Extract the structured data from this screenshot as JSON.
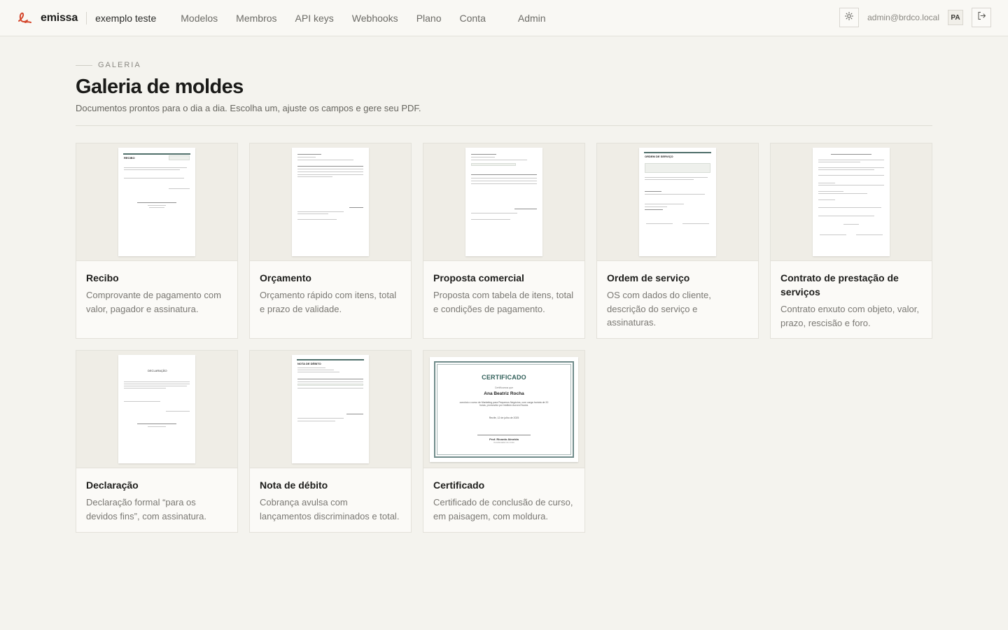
{
  "header": {
    "brand": "emissa",
    "org": "exemplo teste",
    "nav": [
      "Modelos",
      "Membros",
      "API keys",
      "Webhooks",
      "Plano",
      "Conta",
      "Admin"
    ],
    "user_email": "admin@brdco.local",
    "avatar_initials": "PA"
  },
  "page": {
    "eyebrow": "GALERIA",
    "title": "Galeria de moldes",
    "subtitle": "Documentos prontos para o dia a dia. Escolha um, ajuste os campos e gere seu PDF."
  },
  "templates": [
    {
      "name": "Recibo",
      "desc": "Comprovante de pagamento com valor, pagador e assinatura.",
      "thumb_title": "RECIBO"
    },
    {
      "name": "Orçamento",
      "desc": "Orçamento rápido com itens, total e prazo de validade.",
      "thumb_title": ""
    },
    {
      "name": "Proposta comercial",
      "desc": "Proposta com tabela de itens, total e condições de pagamento.",
      "thumb_title": ""
    },
    {
      "name": "Ordem de serviço",
      "desc": "OS com dados do cliente, descrição do serviço e assinaturas.",
      "thumb_title": "ORDEM DE SERVIÇO"
    },
    {
      "name": "Contrato de prestação de serviços",
      "desc": "Contrato enxuto com objeto, valor, prazo, rescisão e foro.",
      "thumb_title": ""
    },
    {
      "name": "Declaração",
      "desc": "Declaração formal “para os devidos fins”, com assinatura.",
      "thumb_title": "DECLARAÇÃO"
    },
    {
      "name": "Nota de débito",
      "desc": "Cobrança avulsa com lançamentos discriminados e total.",
      "thumb_title": "NOTA DE DÉBITO"
    },
    {
      "name": "Certificado",
      "desc": "Certificado de conclusão de curso, em paisagem, com moldura.",
      "thumb_title": "CERTIFICADO"
    }
  ],
  "certificate_preview": {
    "title": "CERTIFICADO",
    "certify": "Certificamos que",
    "recipient": "Ana Beatriz Rocha",
    "body": "concluiu o curso de Marketing para Pequenos Negócios, com carga horária de 20 horas, promovido por Instituto Aurora Escola.",
    "place_date": "Recife, 12 de julho de 2025",
    "signer": "Prof. Ricardo Almeida",
    "signer_role": "Coordenador do curso"
  },
  "colors": {
    "accent": "#d4452a",
    "background": "#f4f3ee",
    "card": "#fbfaf7",
    "certificate_green": "#2f5e58"
  },
  "icons": {
    "logo": "emissa-logo-icon",
    "theme": "sun-icon",
    "logout": "logout-icon"
  }
}
